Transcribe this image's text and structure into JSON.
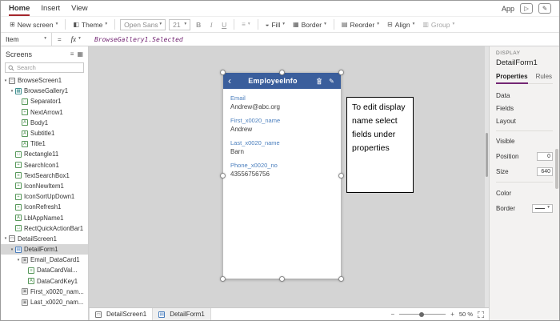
{
  "colors": {
    "accent_purple": "#742774",
    "tab_red": "#a4262c",
    "header_blue": "#3a5e9c",
    "label_blue": "#4a7ebd",
    "canvas_gray": "#d4d4d4",
    "panel_gray": "#f3f2f1",
    "formula_purple": "#742774"
  },
  "icons": {
    "chevron_down": "▾",
    "back_arrow": "‹",
    "pencil": "✎",
    "play": "▷",
    "hamburger": "≡",
    "grid": "▦",
    "new_screen": "⊞",
    "theme": "◧",
    "fill": "◒",
    "border": "▦",
    "reorder": "▤",
    "align_tool": "⊟",
    "group": "▥",
    "text_align": "≡",
    "minus": "−",
    "plus": "+"
  },
  "menubar": {
    "tabs": [
      {
        "label": "Home",
        "active": true
      },
      {
        "label": "Insert",
        "active": false
      },
      {
        "label": "View",
        "active": false
      }
    ],
    "app_label": "App"
  },
  "toolbar": {
    "new_screen": "New screen",
    "theme": "Theme",
    "font": "Open Sans",
    "font_size": "21",
    "bold": "B",
    "italic": "I",
    "underline": "U",
    "fill": "Fill",
    "border": "Border",
    "reorder": "Reorder",
    "align": "Align",
    "group": "Group"
  },
  "formula_bar": {
    "property": "Item",
    "equals": "=",
    "fx": "fx",
    "formula": "BrowseGallery1.Selected"
  },
  "screens_panel": {
    "title": "Screens",
    "search_placeholder": "Search",
    "tree": [
      {
        "label": "BrowseScreen1",
        "level": 0,
        "icon": "screen",
        "expandable": true
      },
      {
        "label": "BrowseGallery1",
        "level": 1,
        "icon": "gallery",
        "expandable": true
      },
      {
        "label": "Separator1",
        "level": 2,
        "icon": "shape"
      },
      {
        "label": "NextArrow1",
        "level": 2,
        "icon": "icon"
      },
      {
        "label": "Body1",
        "level": 2,
        "icon": "label"
      },
      {
        "label": "Subtitle1",
        "level": 2,
        "icon": "label"
      },
      {
        "label": "Title1",
        "level": 2,
        "icon": "label"
      },
      {
        "label": "Rectangle11",
        "level": 1,
        "icon": "shape"
      },
      {
        "label": "SearchIcon1",
        "level": 1,
        "icon": "icon"
      },
      {
        "label": "TextSearchBox1",
        "level": 1,
        "icon": "textbox"
      },
      {
        "label": "IconNewItem1",
        "level": 1,
        "icon": "icon"
      },
      {
        "label": "IconSortUpDown1",
        "level": 1,
        "icon": "icon"
      },
      {
        "label": "IconRefresh1",
        "level": 1,
        "icon": "icon"
      },
      {
        "label": "LblAppName1",
        "level": 1,
        "icon": "label"
      },
      {
        "label": "RectQuickActionBar1",
        "level": 1,
        "icon": "shape"
      },
      {
        "label": "DetailScreen1",
        "level": 0,
        "icon": "screen",
        "expandable": true
      },
      {
        "label": "DetailForm1",
        "level": 1,
        "icon": "form",
        "expandable": true,
        "selected": true
      },
      {
        "label": "Email_DataCard1",
        "level": 2,
        "icon": "card",
        "expandable": true
      },
      {
        "label": "DataCardVal...",
        "level": 3,
        "icon": "textbox"
      },
      {
        "label": "DataCardKey1",
        "level": 3,
        "icon": "label"
      },
      {
        "label": "First_x0020_nam...",
        "level": 2,
        "icon": "card"
      },
      {
        "label": "Last_x0020_nam...",
        "level": 2,
        "icon": "card"
      }
    ]
  },
  "canvas": {
    "app_title": "EmployeeInfo",
    "fields": [
      {
        "label": "Email",
        "value": "Andrew@abc.org"
      },
      {
        "label": "First_x0020_name",
        "value": "Andrew"
      },
      {
        "label": "Last_x0020_name",
        "value": "Barn"
      },
      {
        "label": "Phone_x0020_no",
        "value": "43556756756"
      }
    ],
    "annotation": "To edit display name select fields under properties"
  },
  "properties_panel": {
    "display_label": "DISPLAY",
    "title": "DetailForm1",
    "tabs": [
      {
        "label": "Properties",
        "active": true
      },
      {
        "label": "Rules",
        "active": false
      }
    ],
    "nav_items": [
      "Data",
      "Fields",
      "Layout"
    ],
    "visible_label": "Visible",
    "position_label": "Position",
    "position_value": "0",
    "size_label": "Size",
    "size_value": "640",
    "color_label": "Color",
    "border_label": "Border"
  },
  "status_bar": {
    "tabs": [
      {
        "label": "DetailScreen1",
        "icon": "screen",
        "active": false
      },
      {
        "label": "DetailForm1",
        "icon": "form",
        "active": true
      }
    ],
    "zoom": "50 %"
  }
}
